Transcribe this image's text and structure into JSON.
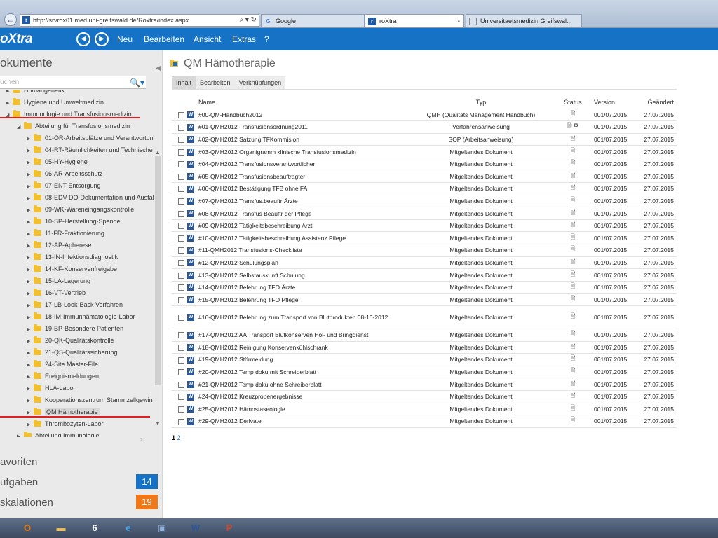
{
  "browser": {
    "url": "http://srvrox01.med.uni-greifswald.de/Roxtra/index.aspx",
    "addr_controls": "⌕ ▾ ↻",
    "tabs": [
      {
        "label": "Google",
        "icon": "google-icon"
      },
      {
        "label": "roXtra",
        "icon": "roxtra-icon"
      },
      {
        "label": "Universitaetsmedizin Greifswal...",
        "icon": "page-icon"
      }
    ]
  },
  "app": {
    "logo": "oXtra",
    "menu": [
      "Neu",
      "Bearbeiten",
      "Ansicht",
      "Extras",
      "?"
    ],
    "accent": "#1572c4"
  },
  "sidebar": {
    "title": "okumente",
    "search_placeholder": "uchen",
    "tree": [
      {
        "label": "Humangenetik",
        "level": 1
      },
      {
        "label": "Hygiene und Umweltmedizin",
        "level": 1
      },
      {
        "label": "Immunologie und Transfusionsmedizin",
        "level": 1,
        "expanded": true
      },
      {
        "label": "Abteilung für Transfusionsmedizin",
        "level": 2,
        "expanded": true
      },
      {
        "label": "01-OR-Arbeitsplätze und Verantwortun",
        "level": 3
      },
      {
        "label": "04-RT-Räumlichkeiten und Technische",
        "level": 3
      },
      {
        "label": "05-HY-Hygiene",
        "level": 3
      },
      {
        "label": "06-AR-Arbeitsschutz",
        "level": 3
      },
      {
        "label": "07-ENT-Entsorgung",
        "level": 3
      },
      {
        "label": "08-EDV-DO-Dokumentation und Ausfall",
        "level": 3
      },
      {
        "label": "09-WK-Wareneingangskontrolle",
        "level": 3
      },
      {
        "label": "10-SP-Herstellung-Spende",
        "level": 3
      },
      {
        "label": "11-FR-Fraktionierung",
        "level": 3
      },
      {
        "label": "12-AP-Apherese",
        "level": 3
      },
      {
        "label": "13-IN-Infektionsdiagnostik",
        "level": 3
      },
      {
        "label": "14-KF-Konservenfreigabe",
        "level": 3
      },
      {
        "label": "15-LA-Lagerung",
        "level": 3
      },
      {
        "label": "16-VT-Vertrieb",
        "level": 3
      },
      {
        "label": "17-LB-Look-Back Verfahren",
        "level": 3
      },
      {
        "label": "18-IM-Immunhämatologie-Labor",
        "level": 3
      },
      {
        "label": "19-BP-Besondere Patienten",
        "level": 3
      },
      {
        "label": "20-QK-Qualitätskontrolle",
        "level": 3
      },
      {
        "label": "21-QS-Qualitätssicherung",
        "level": 3
      },
      {
        "label": "24-Site Master-File",
        "level": 3
      },
      {
        "label": "Ereignismeldungen",
        "level": 3
      },
      {
        "label": "HLA-Labor",
        "level": 3
      },
      {
        "label": "Kooperationszentrum Stammzellgewin",
        "level": 3
      },
      {
        "label": "QM Hämotherapie",
        "level": 3,
        "selected": true
      },
      {
        "label": "Thrombozyten-Labor",
        "level": 3
      },
      {
        "label": "Abteilung Immunologie",
        "level": 2
      }
    ],
    "sections": [
      {
        "label": "avoriten",
        "badge": null
      },
      {
        "label": "ufgaben",
        "badge": "14",
        "color": "#1572c4"
      },
      {
        "label": "skalationen",
        "badge": "19",
        "color": "#f07818"
      }
    ]
  },
  "main": {
    "title": "QM Hämotherapie",
    "tabs": [
      "Inhalt",
      "Bearbeiten",
      "Verknüpfungen"
    ],
    "columns": [
      "Name",
      "Typ",
      "Status",
      "Version",
      "Geändert"
    ],
    "rows": [
      {
        "name": "#00-QM-Handbuch2012",
        "typ": "QMH (Qualitäts Management Handbuch)",
        "version": "001/07.2015",
        "date": "27.07.2015"
      },
      {
        "name": "#01-QMH2012 Transfusionsordnung2011",
        "typ": "Verfahrensanweisung",
        "version": "001/07.2015",
        "date": "27.07.2015",
        "extra": "gear"
      },
      {
        "name": "#02-QMH2012 Satzung TFKommision",
        "typ": "SOP (Arbeitsanweisung)",
        "version": "001/07.2015",
        "date": "27.07.2015"
      },
      {
        "name": "#03-QMH2012 Organigramm klinische Transfusionsmedizin",
        "typ": "Mitgeltendes Dokument",
        "version": "001/07.2015",
        "date": "27.07.2015"
      },
      {
        "name": "#04-QMH2012 Transfusionsverantwortlicher",
        "typ": "Mitgeltendes Dokument",
        "version": "001/07.2015",
        "date": "27.07.2015"
      },
      {
        "name": "#05-QMH2012 Transfusionsbeauftragter",
        "typ": "Mitgeltendes Dokument",
        "version": "001/07.2015",
        "date": "27.07.2015"
      },
      {
        "name": "#06-QMH2012 Bestätigung TFB ohne FA",
        "typ": "Mitgeltendes Dokument",
        "version": "001/07.2015",
        "date": "27.07.2015"
      },
      {
        "name": "#07-QMH2012 Transfus.beauftr Ärzte",
        "typ": "Mitgeltendes Dokument",
        "version": "001/07.2015",
        "date": "27.07.2015"
      },
      {
        "name": "#08-QMH2012 Transfus Beauftr der Pflege",
        "typ": "Mitgeltendes Dokument",
        "version": "001/07.2015",
        "date": "27.07.2015"
      },
      {
        "name": "#09-QMH2012 Tätigkeitsbeschreibung Arzt",
        "typ": "Mitgeltendes Dokument",
        "version": "001/07.2015",
        "date": "27.07.2015"
      },
      {
        "name": "#10-QMH2012 Tätigkeitsbeschreibung Assistenz Pflege",
        "typ": "Mitgeltendes Dokument",
        "version": "001/07.2015",
        "date": "27.07.2015"
      },
      {
        "name": "#11-QMH2012 Transfusions-Checkliste",
        "typ": "Mitgeltendes Dokument",
        "version": "001/07.2015",
        "date": "27.07.2015"
      },
      {
        "name": "#12-QMH2012 Schulungsplan",
        "typ": "Mitgeltendes Dokument",
        "version": "001/07.2015",
        "date": "27.07.2015"
      },
      {
        "name": "#13-QMH2012 Selbstauskunft Schulung",
        "typ": "Mitgeltendes Dokument",
        "version": "001/07.2015",
        "date": "27.07.2015"
      },
      {
        "name": "#14-QMH2012 Belehrung TFO Ärzte",
        "typ": "Mitgeltendes Dokument",
        "version": "001/07.2015",
        "date": "27.07.2015"
      },
      {
        "name": "#15-QMH2012 Belehrung TFO Pflege",
        "typ": "Mitgeltendes Dokument",
        "version": "001/07.2015",
        "date": "27.07.2015"
      },
      {
        "name": "#16-QMH2012 Belehrung zum Transport von Blutprodukten 08-10-2012",
        "typ": "Mitgeltendes Dokument",
        "version": "001/07.2015",
        "date": "27.07.2015",
        "tall": true
      },
      {
        "name": "#17-QMH2012 AA Transport Blutkonserven Hol- und Bringdienst",
        "typ": "Mitgeltendes Dokument",
        "version": "001/07.2015",
        "date": "27.07.2015"
      },
      {
        "name": "#18-QMH2012 Reinigung Konservenkühlschrank",
        "typ": "Mitgeltendes Dokument",
        "version": "001/07.2015",
        "date": "27.07.2015"
      },
      {
        "name": "#19-QMH2012 Störmeldung",
        "typ": "Mitgeltendes Dokument",
        "version": "001/07.2015",
        "date": "27.07.2015"
      },
      {
        "name": "#20-QMH2012 Temp doku mit Schreiberblatt",
        "typ": "Mitgeltendes Dokument",
        "version": "001/07.2015",
        "date": "27.07.2015"
      },
      {
        "name": "#21-QMH2012 Temp doku ohne Schreiberblatt",
        "typ": "Mitgeltendes Dokument",
        "version": "001/07.2015",
        "date": "27.07.2015"
      },
      {
        "name": "#24-QMH2012 Kreuzprobenergebnisse",
        "typ": "Mitgeltendes Dokument",
        "version": "001/07.2015",
        "date": "27.07.2015"
      },
      {
        "name": "#25-QMH2012 Hämostaseologie",
        "typ": "Mitgeltendes Dokument",
        "version": "001/07.2015",
        "date": "27.07.2015"
      },
      {
        "name": "#29-QMH2012 Derivate",
        "typ": "Mitgeltendes Dokument",
        "version": "001/07.2015",
        "date": "27.07.2015"
      }
    ],
    "pager": [
      "1",
      "2"
    ]
  },
  "taskbar": {
    "items": [
      {
        "icon": "outlook-icon",
        "glyph": "O",
        "color": "#e07a10"
      },
      {
        "icon": "explorer-folder-icon",
        "glyph": "▬",
        "color": "#e8c060"
      },
      {
        "icon": "app-flame-icon",
        "glyph": "6",
        "color": "#ffffff"
      },
      {
        "icon": "internet-explorer-icon",
        "glyph": "e",
        "color": "#3aa0e8"
      },
      {
        "icon": "network-computer-icon",
        "glyph": "▣",
        "color": "#8fb0d8"
      },
      {
        "icon": "word-icon",
        "glyph": "W",
        "color": "#2b5797"
      },
      {
        "icon": "powerpoint-icon",
        "glyph": "P",
        "color": "#d24726"
      }
    ]
  }
}
